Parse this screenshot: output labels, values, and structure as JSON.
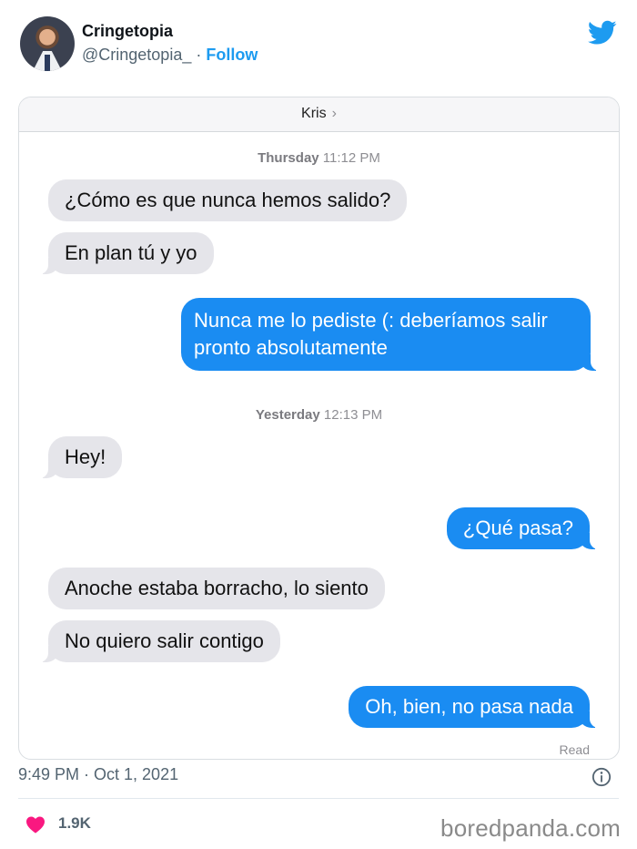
{
  "tweet": {
    "display_name": "Cringetopia",
    "handle": "@Cringetopia_",
    "separator": " · ",
    "follow_label": "Follow",
    "time": "9:49 PM · Oct 1, 2021",
    "likes": "1.9K",
    "icons": {
      "brand": "twitter-bird-icon",
      "info": "info-icon",
      "like": "heart-icon"
    },
    "colors": {
      "accent": "#1d9bf0",
      "like": "#f91880",
      "muted": "#536471"
    }
  },
  "conversation": {
    "contact_name": "Kris",
    "contact_chevron": "›",
    "timestamps": [
      {
        "day": "Thursday",
        "time": "11:12 PM"
      },
      {
        "day": "Yesterday",
        "time": "12:13 PM"
      }
    ],
    "messages": [
      {
        "direction": "incoming",
        "text": "¿Cómo es que nunca hemos salido?"
      },
      {
        "direction": "incoming",
        "text": "En plan tú y yo"
      },
      {
        "direction": "outgoing",
        "text": "Nunca me lo pediste (: deberíamos salir pronto absolutamente"
      },
      {
        "direction": "incoming",
        "text": "Hey!"
      },
      {
        "direction": "outgoing",
        "text": "¿Qué pasa?"
      },
      {
        "direction": "incoming",
        "text": "Anoche estaba borracho, lo siento"
      },
      {
        "direction": "incoming",
        "text": "No quiero salir contigo"
      },
      {
        "direction": "outgoing",
        "text": "Oh, bien, no pasa nada"
      }
    ],
    "read_receipt": "Read",
    "colors": {
      "incoming": "#e5e5ea",
      "outgoing": "#1a8cf2"
    }
  },
  "watermark": "boredpanda.com"
}
